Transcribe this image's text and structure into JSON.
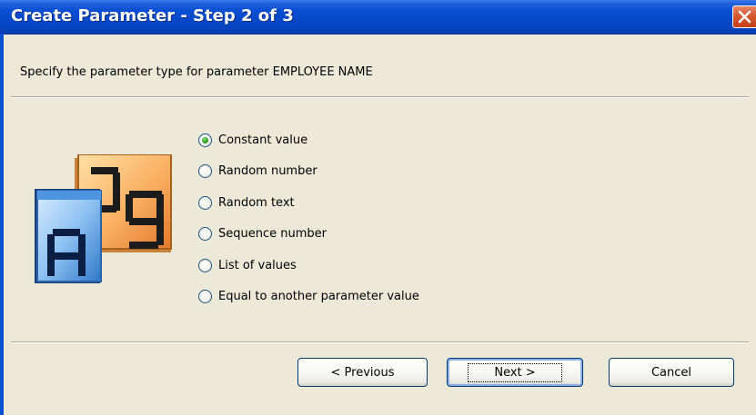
{
  "dialog": {
    "title": "Create Parameter - Step 2 of 3",
    "instruction": "Specify the parameter type for parameter EMPLOYEE NAME"
  },
  "parameter_types": [
    {
      "label": "Constant value",
      "selected": true
    },
    {
      "label": "Random number",
      "selected": false
    },
    {
      "label": "Random text",
      "selected": false
    },
    {
      "label": "Sequence number",
      "selected": false
    },
    {
      "label": "List of values",
      "selected": false
    },
    {
      "label": "Equal to another parameter value",
      "selected": false
    }
  ],
  "buttons": {
    "previous": "< Previous",
    "next": "Next >",
    "cancel": "Cancel"
  },
  "colors": {
    "titlebar": "#0A4FD4",
    "dialog_bg": "#ECE9D8",
    "radio_selected": "#2E9C22",
    "close_button": "#D6572F"
  },
  "icons": {
    "close": "close-icon",
    "parameter": "parameter-type-icon"
  }
}
